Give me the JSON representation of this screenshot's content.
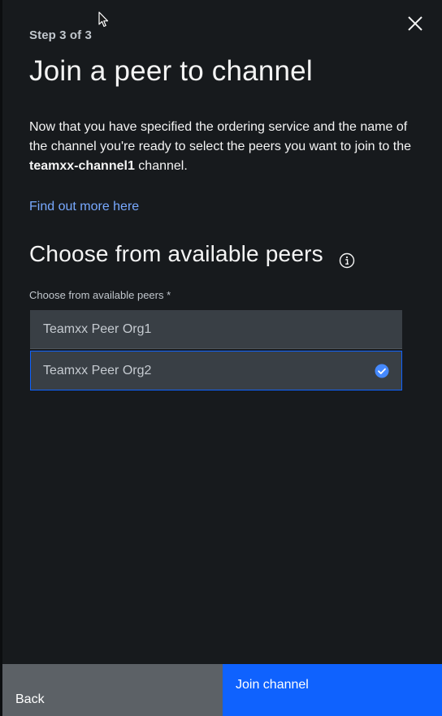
{
  "header": {
    "step_label": "Step 3 of 3",
    "close_icon": "close-icon",
    "title": "Join a peer to channel"
  },
  "description": {
    "text_before": "Now that you have specified the ordering service and the name of the channel you're ready to select the peers you want to join to the ",
    "channel_name": "teamxx-channel1",
    "text_after": " channel."
  },
  "link": {
    "label": "Find out more here"
  },
  "peers_section": {
    "title": "Choose from available peers",
    "info_icon": "info-icon",
    "field_label": "Choose from available peers *",
    "peers": [
      {
        "label": "Teamxx Peer Org1",
        "selected": false
      },
      {
        "label": "Teamxx Peer Org2",
        "selected": true
      }
    ],
    "check_icon": "checkmark-filled-icon"
  },
  "footer": {
    "back_label": "Back",
    "join_label": "Join channel"
  },
  "colors": {
    "background": "#171a1d",
    "accent": "#0f62fe",
    "link": "#78a9ff",
    "tile": "#393f45",
    "back_button": "#5c6166"
  }
}
